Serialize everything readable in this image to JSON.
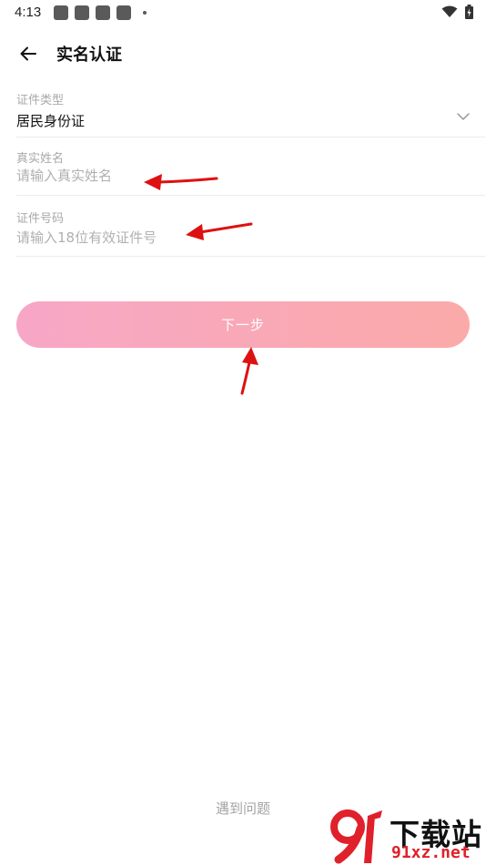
{
  "status_bar": {
    "time": "4:13"
  },
  "header": {
    "title": "实名认证"
  },
  "form": {
    "id_type": {
      "label": "证件类型",
      "value": "居民身份证"
    },
    "real_name": {
      "label": "真实姓名",
      "placeholder": "请输入真实姓名"
    },
    "id_number": {
      "label": "证件号码",
      "placeholder": "请输入18位有效证件号"
    }
  },
  "next_button": {
    "label": "下一步"
  },
  "help_link": {
    "label": "遇到问题"
  },
  "watermark": {
    "brand": "下载站",
    "url": "91xz.net"
  },
  "colors": {
    "button_gradient_start": "#f7a7c6",
    "button_gradient_end": "#fbaaa9",
    "annotation_arrow": "#dd1111",
    "watermark_red": "#e0202a"
  }
}
